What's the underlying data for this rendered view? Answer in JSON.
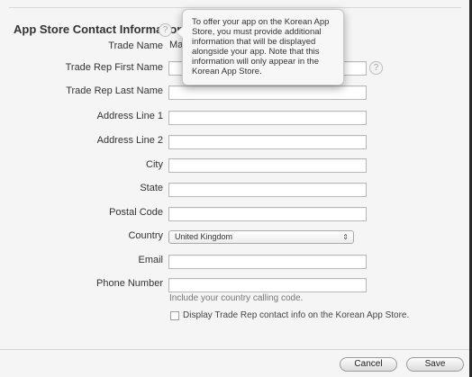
{
  "section": {
    "title": "App Store Contact Information",
    "help_glyph": "?"
  },
  "fields": {
    "trade_name": {
      "label": "Trade Name",
      "value": "Mat"
    },
    "first_name": {
      "label": "Trade Rep First Name",
      "value": ""
    },
    "last_name": {
      "label": "Trade Rep Last Name",
      "value": ""
    },
    "address1": {
      "label": "Address Line 1",
      "value": ""
    },
    "address2": {
      "label": "Address Line 2",
      "value": ""
    },
    "city": {
      "label": "City",
      "value": ""
    },
    "state": {
      "label": "State",
      "value": ""
    },
    "postal_code": {
      "label": "Postal Code",
      "value": ""
    },
    "country": {
      "label": "Country",
      "selected": "United Kingdom"
    },
    "email": {
      "label": "Email",
      "value": ""
    },
    "phone": {
      "label": "Phone Number",
      "value": "",
      "hint": "Include your country calling code."
    }
  },
  "display_checkbox": {
    "label": "Display Trade Rep contact info on the Korean App Store."
  },
  "tooltip": {
    "text": "To offer your app on the Korean App Store, you must provide additional information that will be displayed alongside your app. Note that this information will only appear in the Korean App Store."
  },
  "buttons": {
    "cancel": "Cancel",
    "save": "Save"
  },
  "icons": {
    "help": "help-icon",
    "dropdown": "dropdown-arrow-icon"
  }
}
